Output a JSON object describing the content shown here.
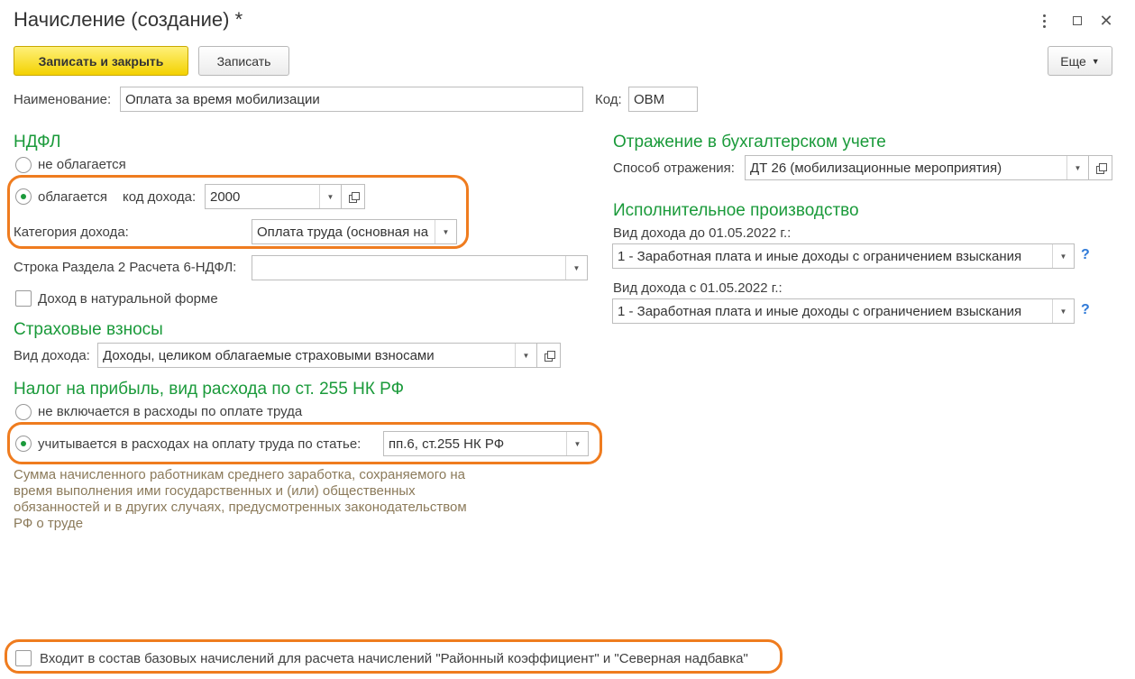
{
  "window": {
    "title": "Начисление (создание) *",
    "close_glyph": "✕"
  },
  "toolbar": {
    "save_close_label": "Записать и закрыть",
    "save_label": "Записать",
    "more_label": "Еще",
    "more_caret": "▼"
  },
  "header": {
    "name_label": "Наименование:",
    "name_value": "Оплата за время мобилизации",
    "code_label": "Код:",
    "code_value": "ОВМ"
  },
  "ndfl": {
    "section_title": "НДФЛ",
    "not_taxed_label": "не облагается",
    "taxed_label": "облагается",
    "income_code_label": "код дохода:",
    "income_code_value": "2000",
    "income_category_label": "Категория дохода:",
    "income_category_value": "Оплата труда (основная на",
    "row_6ndfl_label": "Строка Раздела 2 Расчета 6-НДФЛ:",
    "row_6ndfl_value": "",
    "in_kind_label": "Доход в натуральной форме",
    "selected": "taxed"
  },
  "insurance": {
    "section_title": "Страховые взносы",
    "income_type_label": "Вид дохода:",
    "income_type_value": "Доходы, целиком облагаемые страховыми взносами"
  },
  "profit_tax": {
    "section_title": "Налог на прибыль, вид расхода по ст. 255 НК РФ",
    "not_included_label": "не включается в расходы по оплате труда",
    "included_label": "учитывается в расходах на оплату труда по статье:",
    "article_value": "пп.6, ст.255 НК РФ",
    "selected": "included",
    "note": "Сумма начисленного работникам среднего заработка, сохраняемого на время выполнения ими государственных и (или) общественных обязанностей и в других случаях, предусмотренных законодательством РФ о труде"
  },
  "accounting": {
    "section_title": "Отражение в бухгалтерском учете",
    "method_label": "Способ отражения:",
    "method_value": "ДТ 26 (мобилизационные мероприятия)"
  },
  "enforcement": {
    "section_title": "Исполнительное производство",
    "before_label": "Вид дохода до 01.05.2022 г.:",
    "before_value": "1 - Заработная плата и иные доходы с ограничением взыскания",
    "after_label": "Вид дохода с 01.05.2022 г.:",
    "after_value": "1 - Заработная плата и иные доходы с ограничением взыскания",
    "help_glyph": "?"
  },
  "footer": {
    "base_accrual_label": "Входит в состав базовых начислений для расчета начислений \"Районный коэффициент\" и \"Северная надбавка\""
  },
  "colors": {
    "section": "#1a9a3a",
    "highlight": "#ef7c1f",
    "primary_button": "#f3d100",
    "help": "#2f7ad8"
  }
}
